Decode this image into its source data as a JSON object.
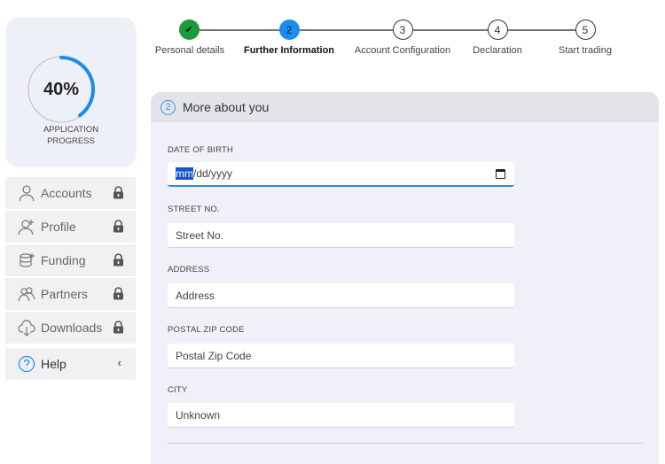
{
  "progress": {
    "percent_value": 40,
    "percent": "40%",
    "label_line1": "APPLICATION",
    "label_line2": "PROGRESS",
    "accent": "#1a8cf0"
  },
  "sidebar": {
    "items": [
      {
        "label": "Accounts",
        "icon": "user-icon",
        "locked": true
      },
      {
        "label": "Profile",
        "icon": "user-plus-icon",
        "locked": true
      },
      {
        "label": "Funding",
        "icon": "coins-icon",
        "locked": true
      },
      {
        "label": "Partners",
        "icon": "users-icon",
        "locked": true
      },
      {
        "label": "Downloads",
        "icon": "cloud-download-icon",
        "locked": true
      },
      {
        "label": "Help",
        "icon": "help-icon",
        "chevron": "‹"
      }
    ]
  },
  "stepper": {
    "steps": [
      {
        "num": "✔",
        "label": "Personal details",
        "state": "done"
      },
      {
        "num": "2",
        "label": "Further Information",
        "state": "active"
      },
      {
        "num": "3",
        "label": "Account Configuration",
        "state": "pending"
      },
      {
        "num": "4",
        "label": "Declaration",
        "state": "pending"
      },
      {
        "num": "5",
        "label": "Start trading",
        "state": "pending"
      }
    ],
    "done_color": "#1e9a3e",
    "active_color": "#1a8cf0"
  },
  "section": {
    "number": "2",
    "title": "More about you"
  },
  "form": {
    "dob": {
      "label": "DATE OF BIRTH",
      "value_mm": "mm",
      "value_rest": "/dd/yyyy"
    },
    "street": {
      "label": "STREET NO.",
      "placeholder": "Street No."
    },
    "address": {
      "label": "ADDRESS",
      "placeholder": "Address"
    },
    "zip": {
      "label": "POSTAL ZIP CODE",
      "placeholder": "Postal Zip Code"
    },
    "city": {
      "label": "CITY",
      "value": "Unknown"
    }
  }
}
